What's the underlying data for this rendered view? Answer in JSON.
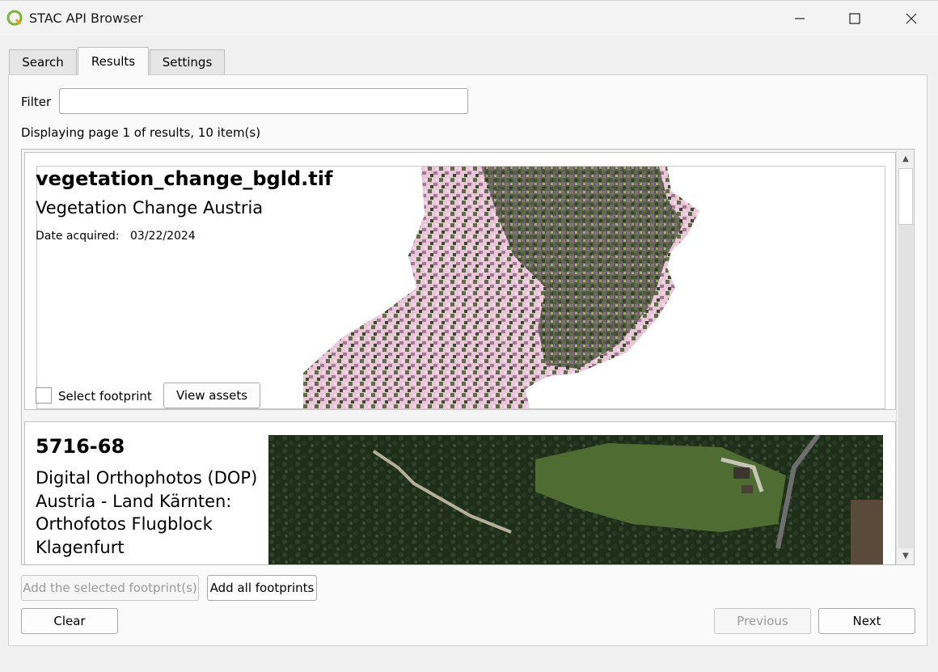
{
  "window": {
    "title": "STAC API Browser"
  },
  "tabs": [
    "Search",
    "Results",
    "Settings"
  ],
  "filter": {
    "label": "Filter",
    "value": ""
  },
  "status_text": "Displaying page 1 of results, 10 item(s)",
  "items": [
    {
      "title": "vegetation_change_bgld.tif",
      "collection": "Vegetation Change Austria",
      "date_label": "Date acquired:",
      "date_value": "03/22/2024",
      "select_label": "Select footprint",
      "view_assets_label": "View assets"
    },
    {
      "title": "5716-68",
      "collection_lines": [
        "Digital Orthophotos (DOP)",
        "Austria - Land Kärnten:",
        "Orthofotos Flugblock",
        "Klagenfurt"
      ]
    }
  ],
  "buttons": {
    "add_selected": "Add the selected footprint(s)",
    "add_all": "Add all footprints",
    "clear": "Clear",
    "previous": "Previous",
    "next": "Next"
  },
  "icons": [
    "qgis-logo-icon",
    "minimize-icon",
    "maximize-icon",
    "close-icon",
    "scroll-up-icon",
    "scroll-down-icon"
  ]
}
